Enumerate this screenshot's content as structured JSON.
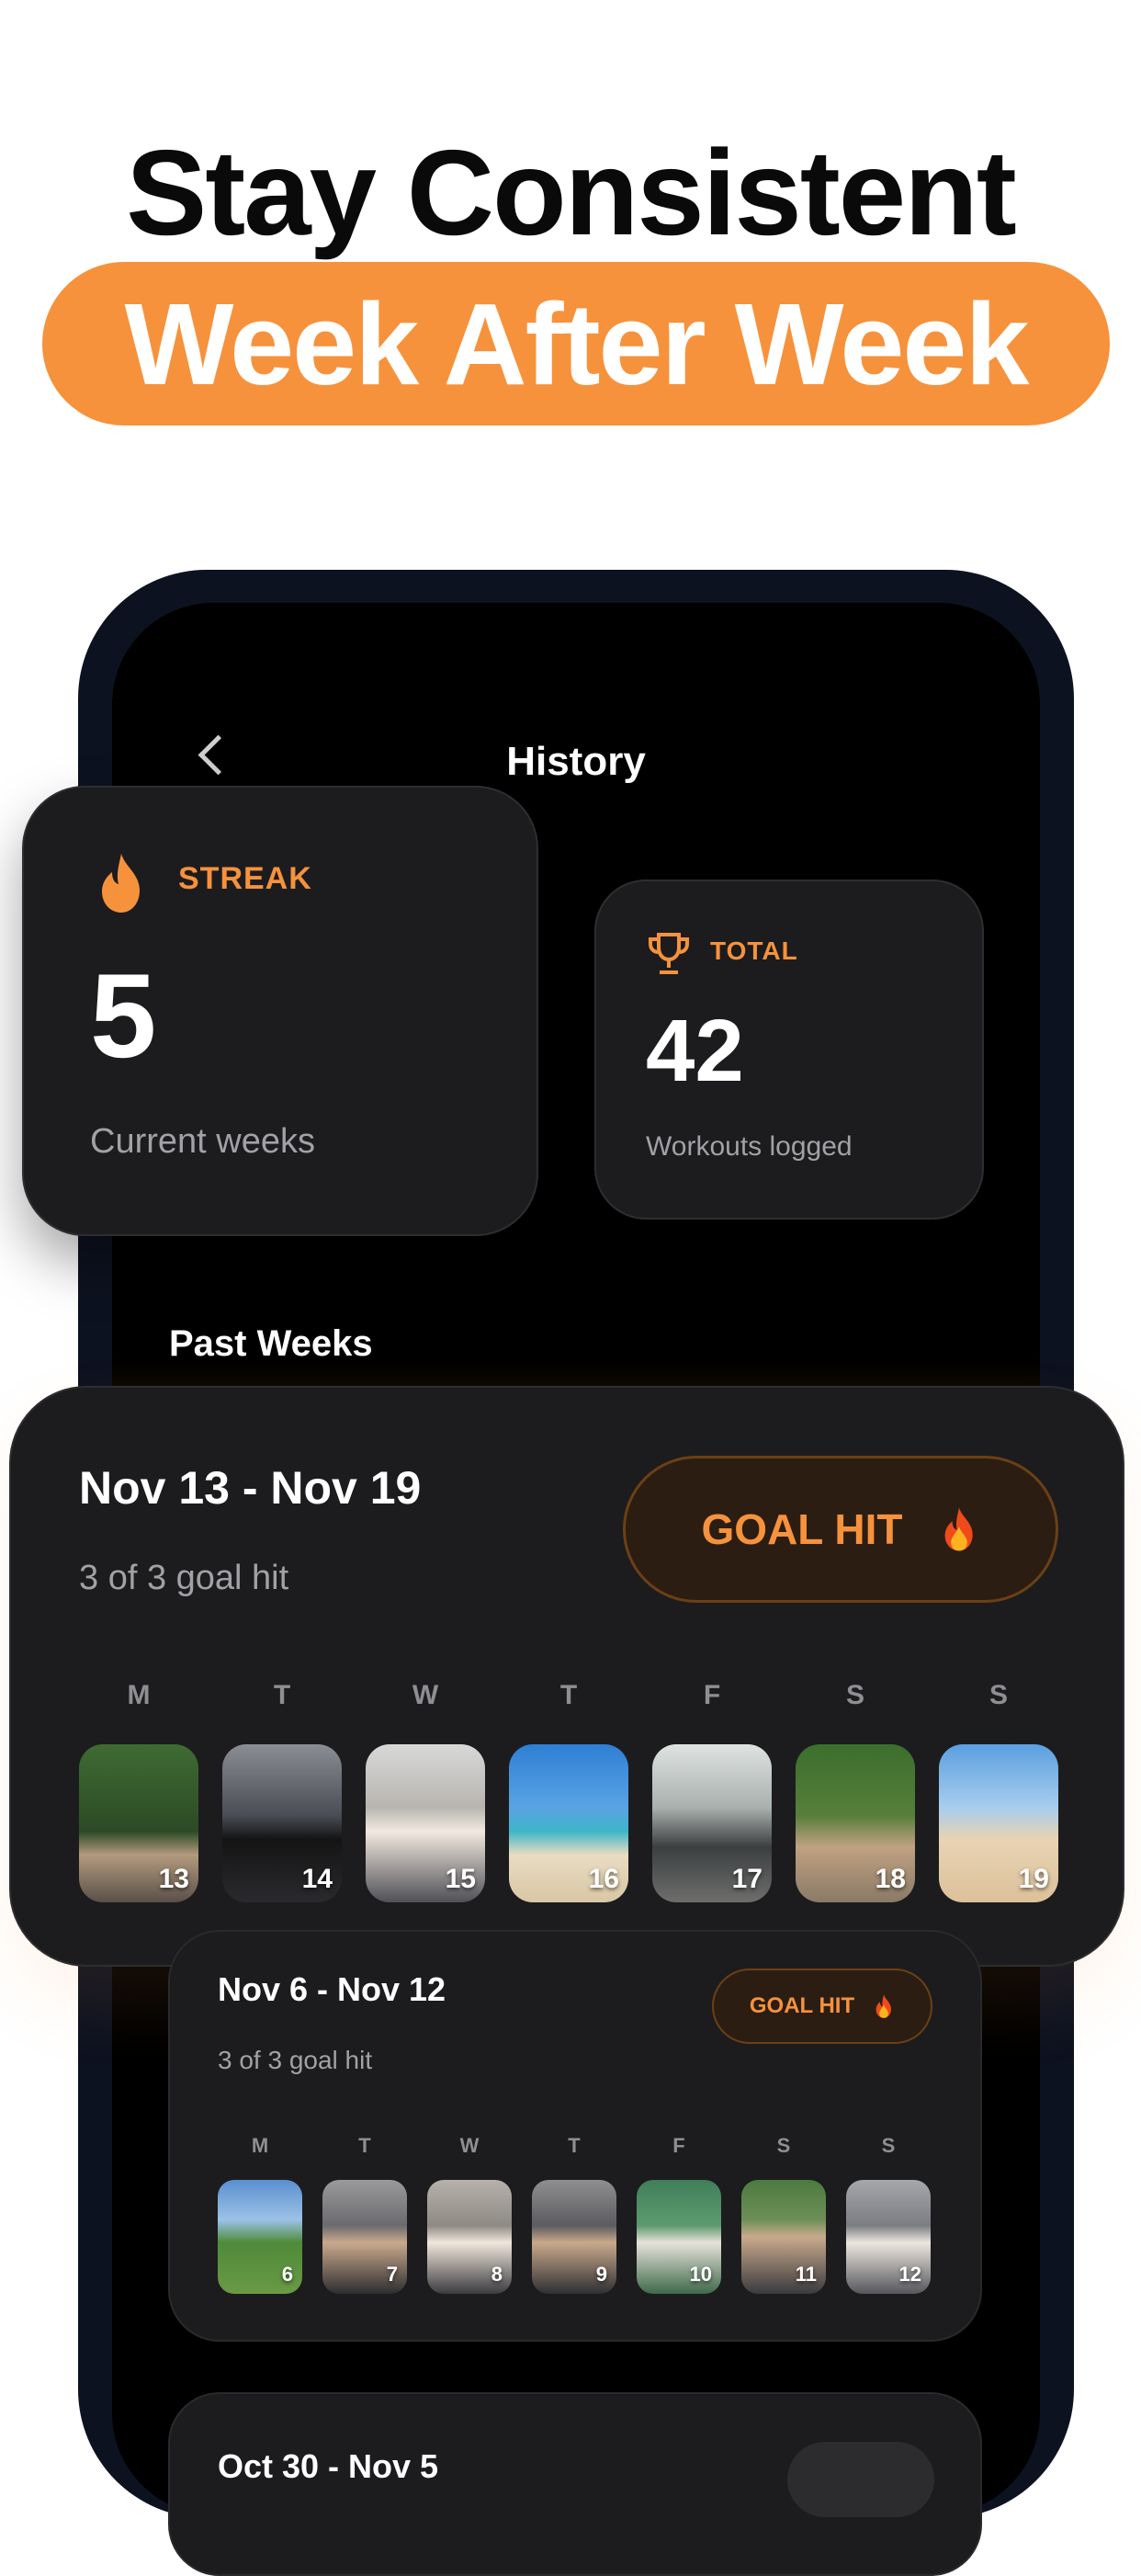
{
  "headline": {
    "line1": "Stay Consistent",
    "line2": "Week After Week"
  },
  "screen": {
    "title": "History",
    "past_weeks_label": "Past Weeks"
  },
  "streak": {
    "label": "STREAK",
    "value": "5",
    "caption": "Current weeks"
  },
  "total": {
    "label": "TOTAL",
    "value": "42",
    "caption": "Workouts logged"
  },
  "weeks": [
    {
      "range": "Nov 13 - Nov 19",
      "summary": "3 of 3 goal hit",
      "badge": "GOAL HIT",
      "days": [
        "M",
        "T",
        "W",
        "T",
        "F",
        "S",
        "S"
      ],
      "dates": [
        "13",
        "14",
        "15",
        "16",
        "17",
        "18",
        "19"
      ]
    },
    {
      "range": "Nov 6 - Nov 12",
      "summary": "3 of 3 goal hit",
      "badge": "GOAL HIT",
      "days": [
        "M",
        "T",
        "W",
        "T",
        "F",
        "S",
        "S"
      ],
      "dates": [
        "6",
        "7",
        "8",
        "9",
        "10",
        "11",
        "12"
      ]
    },
    {
      "range": "Oct 30 - Nov 5"
    }
  ],
  "colors": {
    "accent": "#f6923c",
    "card": "#1c1c1e",
    "screen": "#000000"
  },
  "icons": {
    "back": "chevron-left-icon",
    "streak": "flame-icon",
    "total": "trophy-icon",
    "badge": "flame-icon"
  }
}
